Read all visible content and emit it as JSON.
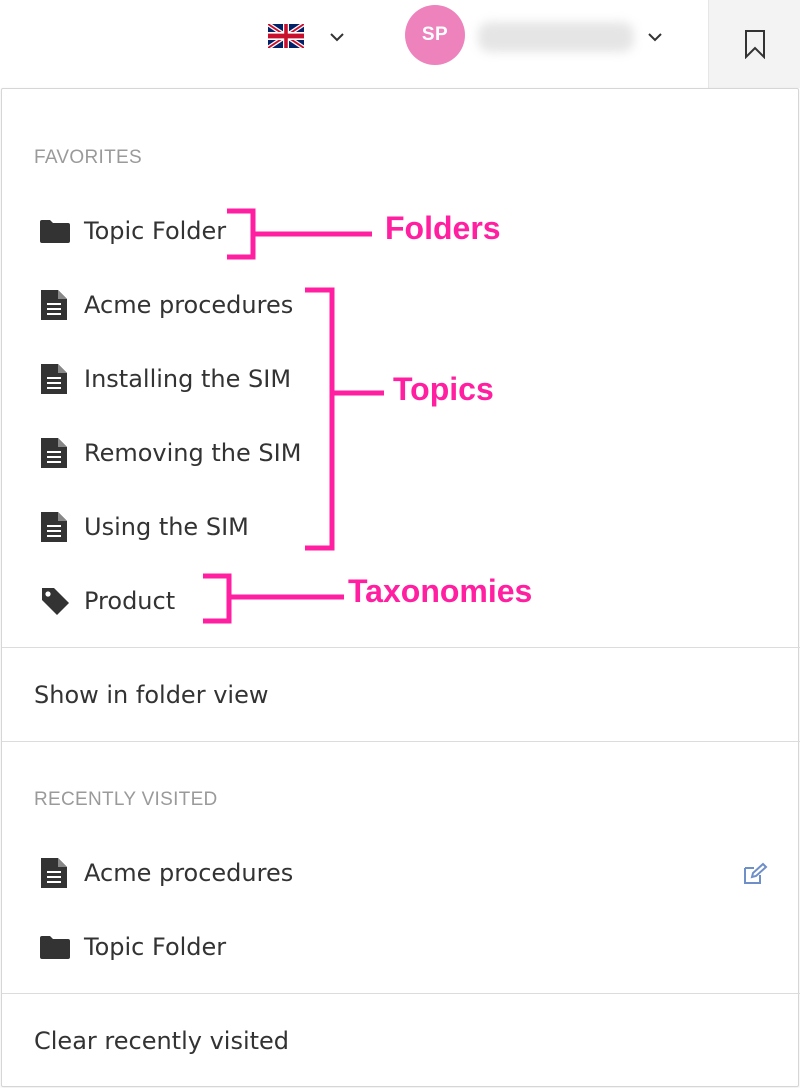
{
  "header": {
    "language_flag": "uk-flag-icon",
    "avatar_initials": "SP",
    "bookmark_icon": "bookmark-icon"
  },
  "favorites": {
    "title": "FAVORITES",
    "items": [
      {
        "icon": "folder-icon",
        "label": "Topic Folder"
      },
      {
        "icon": "document-icon",
        "label": "Acme procedures"
      },
      {
        "icon": "document-icon",
        "label": "Installing the SIM"
      },
      {
        "icon": "document-icon",
        "label": "Removing the SIM"
      },
      {
        "icon": "document-icon",
        "label": "Using the SIM"
      },
      {
        "icon": "tag-icon",
        "label": "Product"
      }
    ]
  },
  "show_in_folder_view": "Show in folder view",
  "recently_visited": {
    "title": "RECENTLY VISITED",
    "items": [
      {
        "icon": "document-icon",
        "label": "Acme procedures"
      },
      {
        "icon": "folder-icon",
        "label": "Topic Folder"
      }
    ]
  },
  "clear_recently_visited": "Clear recently visited",
  "annotations": {
    "folders": "Folders",
    "topics": "Topics",
    "taxonomies": "Taxonomies"
  },
  "colors": {
    "annotation": "#ff1fa0",
    "avatar": "#ee82bd",
    "edit_icon": "#6f8fc8"
  }
}
